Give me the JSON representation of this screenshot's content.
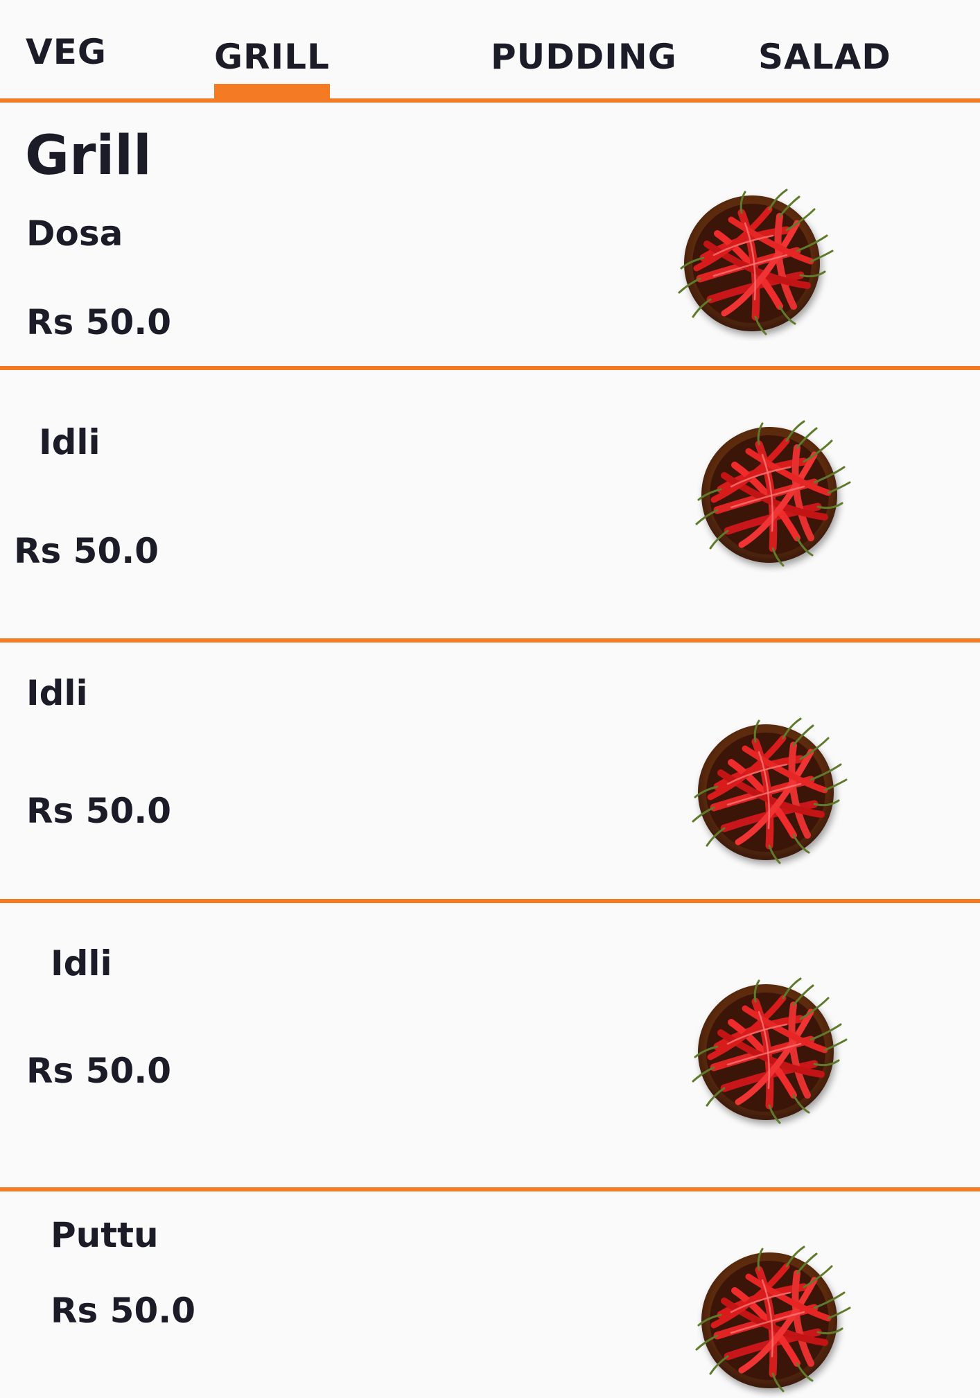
{
  "tabs": [
    {
      "label": "VEG",
      "active": false
    },
    {
      "label": "GRILL",
      "active": true
    },
    {
      "label": "PUDDING",
      "active": false
    },
    {
      "label": "SALAD",
      "active": false
    }
  ],
  "accent_color": "#f57a24",
  "section_title": "Grill",
  "items": [
    {
      "name": "Dosa",
      "price": "Rs 50.0",
      "image_icon": "chili-bowl-icon"
    },
    {
      "name": "Idli",
      "price": "Rs 50.0",
      "image_icon": "chili-bowl-icon"
    },
    {
      "name": "Idli",
      "price": "Rs 50.0",
      "image_icon": "chili-bowl-icon"
    },
    {
      "name": "Idli",
      "price": "Rs 50.0",
      "image_icon": "chili-bowl-icon"
    },
    {
      "name": "Puttu",
      "price": "Rs 50.0",
      "image_icon": "chili-bowl-icon"
    }
  ]
}
